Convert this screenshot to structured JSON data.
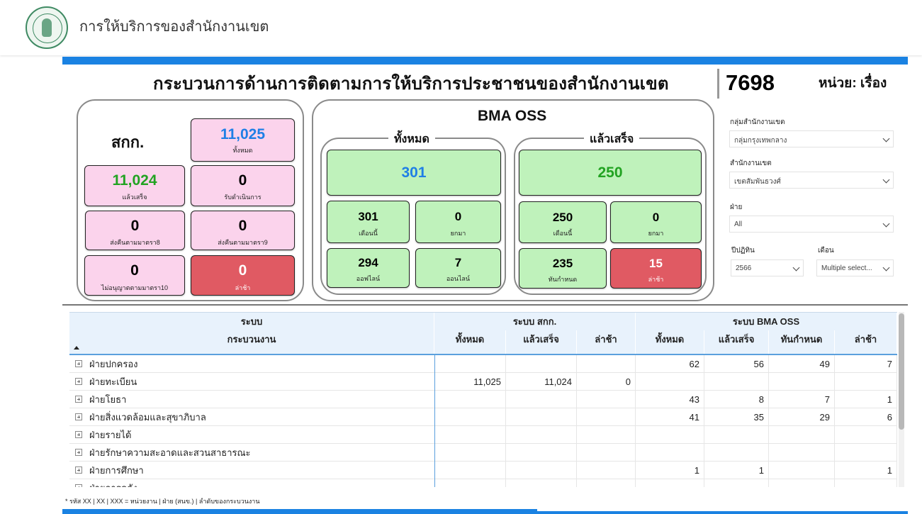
{
  "app": {
    "title": "การให้บริการของสำนักงานเขต"
  },
  "header": {
    "main_title": "กระบวนการด้านการติดตามการให้บริการประชาชนของสำนักงานเขต",
    "total": "7698",
    "unit": "หน่วย: เรื่อง"
  },
  "sakk": {
    "label": "สกก.",
    "total": {
      "value": "11,025",
      "label": "ทั้งหมด"
    },
    "done": {
      "value": "11,024",
      "label": "แล้วเสร็จ"
    },
    "accepted": {
      "value": "0",
      "label": "รับดำเนินการ"
    },
    "return8": {
      "value": "0",
      "label": "ส่งคืนตามมาตรา8"
    },
    "return9": {
      "value": "0",
      "label": "ส่งคืนตามมาตรา9"
    },
    "deny10": {
      "value": "0",
      "label": "ไม่อนุญาตตามมาตรา10"
    },
    "late": {
      "value": "0",
      "label": "ล่าช้า"
    }
  },
  "bma": {
    "title": "BMA OSS",
    "all": {
      "legend": "ทั้งหมด",
      "total": "301",
      "month": {
        "value": "301",
        "label": "เดือนนี้"
      },
      "carry": {
        "value": "0",
        "label": "ยกมา"
      },
      "offline": {
        "value": "294",
        "label": "ออฟไลน์"
      },
      "online": {
        "value": "7",
        "label": "ออนไลน์"
      }
    },
    "done": {
      "legend": "แล้วเสร็จ",
      "total": "250",
      "month": {
        "value": "250",
        "label": "เดือนนี้"
      },
      "carry": {
        "value": "0",
        "label": "ยกมา"
      },
      "ontime": {
        "value": "235",
        "label": "ทันกำหนด"
      },
      "late": {
        "value": "15",
        "label": "ล่าช้า"
      }
    }
  },
  "filters": {
    "group_label": "กลุ่มสำนักงานเขต",
    "group_value": "กลุ่มกรุงเทพกลาง",
    "district_label": "สำนักงานเขต",
    "district_value": "เขตสัมพันธวงศ์",
    "dept_label": "ฝ่าย",
    "dept_value": "All",
    "year_label": "ปีปฏิทิน",
    "year_value": "2566",
    "month_label": "เดือน",
    "month_value": "Multiple select..."
  },
  "table": {
    "h_system": "ระบบ",
    "h_process": "กระบวนงาน",
    "h_sakk": "ระบบ สกก.",
    "h_bma": "ระบบ BMA OSS",
    "cols": [
      "ทั้งหมด",
      "แล้วเสร็จ",
      "ล่าช้า",
      "ทั้งหมด",
      "แล้วเสร็จ",
      "ทันกำหนด",
      "ล่าช้า"
    ],
    "rows": [
      {
        "name": "ฝ่ายปกครอง",
        "v": [
          "",
          "",
          "",
          "62",
          "56",
          "49",
          "7"
        ]
      },
      {
        "name": "ฝ่ายทะเบียน",
        "v": [
          "11,025",
          "11,024",
          "0",
          "",
          "",
          "",
          ""
        ]
      },
      {
        "name": "ฝ่ายโยธา",
        "v": [
          "",
          "",
          "",
          "43",
          "8",
          "7",
          "1"
        ]
      },
      {
        "name": "ฝ่ายสิ่งแวดล้อมและสุขาภิบาล",
        "v": [
          "",
          "",
          "",
          "41",
          "35",
          "29",
          "6"
        ]
      },
      {
        "name": "ฝ่ายรายได้",
        "v": [
          "",
          "",
          "",
          "",
          "",
          "",
          ""
        ]
      },
      {
        "name": "ฝ่ายรักษาความสะอาดและสวนสาธารณะ",
        "v": [
          "",
          "",
          "",
          "",
          "",
          "",
          ""
        ]
      },
      {
        "name": "ฝ่ายการศึกษา",
        "v": [
          "",
          "",
          "",
          "1",
          "1",
          "",
          "1"
        ]
      },
      {
        "name": "ฝ่ายการคลัง",
        "v": [
          "",
          "",
          "",
          "",
          "",
          "",
          ""
        ]
      }
    ]
  },
  "footnote": "* รหัส XX | XX | XXX = หน่วยงาน | ฝ่าย (สนข.) | ลำดับของกระบวนงาน"
}
